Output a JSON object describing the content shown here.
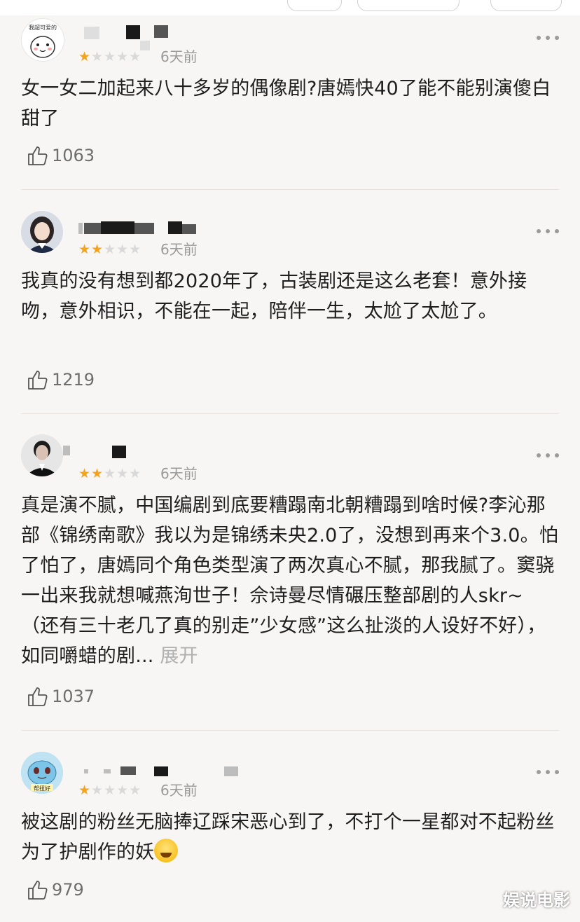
{
  "watermark": "娱说电影",
  "reviews": [
    {
      "avatar_label": "我超可爱的",
      "stars": 1,
      "time": "6天前",
      "content": "女一女二加起来八十多岁的偶像剧?唐嫣快40了能不能别演傻白甜了",
      "likes": "1063"
    },
    {
      "stars": 2,
      "time": "6天前",
      "content": "我真的没有想到都2020年了，古装剧还是这么老套！意外接吻，意外相识，不能在一起，陪伴一生，太尬了太尬了。",
      "likes": "1219"
    },
    {
      "stars": 2,
      "time": "6天前",
      "content": "真是演不腻，中国编剧到底要糟蹋南北朝糟蹋到啥时候?李沁那部《锦绣南歌》我以为是锦绣未央2.0了，没想到再来个3.0。怕了怕了，唐嫣同个角色类型演了两次真心不腻，那我腻了。窦骁一出来我就想喊燕洵世子！佘诗曼尽情碾压整部剧的人skr~（还有三十老几了真的别走”少女感”这么扯淡的人设好不好），如同嚼蜡的剧...",
      "expand": "展开",
      "likes": "1037"
    },
    {
      "avatar_label": "帮扭好",
      "stars": 1,
      "time": "6天前",
      "content": "被这剧的粉丝无脑捧辽踩宋恶心到了，不打个一星都对不起粉丝为了护剧作的妖",
      "likes": "979"
    }
  ],
  "colors": {
    "star_on": "#f5a31a",
    "star_off": "#d9d9d9",
    "expand": "#b0b0b0"
  },
  "icons": {
    "like": "thumbs-up-icon",
    "more": "more-dots-icon"
  }
}
